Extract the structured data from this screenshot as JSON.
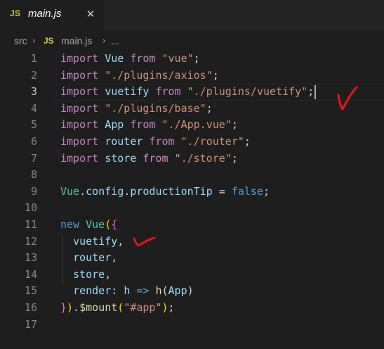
{
  "tab": {
    "badge": "JS",
    "filename": "main.js",
    "close": "✕"
  },
  "breadcrumb": {
    "folder": "src",
    "sep": "›",
    "badge": "JS",
    "file": "main.js",
    "ellipsis": "..."
  },
  "lines": [
    {
      "n": "1",
      "tokens": [
        [
          "kw",
          "import"
        ],
        [
          "sp",
          " "
        ],
        [
          "id",
          "Vue"
        ],
        [
          "sp",
          " "
        ],
        [
          "kw",
          "from"
        ],
        [
          "sp",
          " "
        ],
        [
          "str",
          "\"vue\""
        ],
        [
          "pun",
          ";"
        ]
      ]
    },
    {
      "n": "2",
      "tokens": [
        [
          "kw",
          "import"
        ],
        [
          "sp",
          " "
        ],
        [
          "str",
          "\"./plugins/axios\""
        ],
        [
          "pun",
          ";"
        ]
      ]
    },
    {
      "n": "3",
      "tokens": [
        [
          "kw",
          "import"
        ],
        [
          "sp",
          " "
        ],
        [
          "id",
          "vuetify"
        ],
        [
          "sp",
          " "
        ],
        [
          "kw",
          "from"
        ],
        [
          "sp",
          " "
        ],
        [
          "str",
          "\"./plugins/vuetify\""
        ],
        [
          "pun",
          ";"
        ]
      ]
    },
    {
      "n": "4",
      "tokens": [
        [
          "kw",
          "import"
        ],
        [
          "sp",
          " "
        ],
        [
          "str",
          "\"./plugins/base\""
        ],
        [
          "pun",
          ";"
        ]
      ]
    },
    {
      "n": "5",
      "tokens": [
        [
          "kw",
          "import"
        ],
        [
          "sp",
          " "
        ],
        [
          "id",
          "App"
        ],
        [
          "sp",
          " "
        ],
        [
          "kw",
          "from"
        ],
        [
          "sp",
          " "
        ],
        [
          "str",
          "\"./App.vue\""
        ],
        [
          "pun",
          ";"
        ]
      ]
    },
    {
      "n": "6",
      "tokens": [
        [
          "kw",
          "import"
        ],
        [
          "sp",
          " "
        ],
        [
          "id",
          "router"
        ],
        [
          "sp",
          " "
        ],
        [
          "kw",
          "from"
        ],
        [
          "sp",
          " "
        ],
        [
          "str",
          "\"./router\""
        ],
        [
          "pun",
          ";"
        ]
      ]
    },
    {
      "n": "7",
      "tokens": [
        [
          "kw",
          "import"
        ],
        [
          "sp",
          " "
        ],
        [
          "id",
          "store"
        ],
        [
          "sp",
          " "
        ],
        [
          "kw",
          "from"
        ],
        [
          "sp",
          " "
        ],
        [
          "str",
          "\"./store\""
        ],
        [
          "pun",
          ";"
        ]
      ]
    },
    {
      "n": "8",
      "tokens": []
    },
    {
      "n": "9",
      "tokens": [
        [
          "cls",
          "Vue"
        ],
        [
          "pun",
          "."
        ],
        [
          "id",
          "config"
        ],
        [
          "pun",
          "."
        ],
        [
          "id",
          "productionTip"
        ],
        [
          "sp",
          " "
        ],
        [
          "pun",
          "="
        ],
        [
          "sp",
          " "
        ],
        [
          "bool",
          "false"
        ],
        [
          "pun",
          ";"
        ]
      ]
    },
    {
      "n": "10",
      "tokens": []
    },
    {
      "n": "11",
      "tokens": [
        [
          "stor",
          "new"
        ],
        [
          "sp",
          " "
        ],
        [
          "cls",
          "Vue"
        ],
        [
          "b1",
          "("
        ],
        [
          "b2",
          "{"
        ]
      ]
    },
    {
      "n": "12",
      "tokens": [
        [
          "sp",
          "  "
        ],
        [
          "id",
          "vuetify"
        ],
        [
          "pun",
          ","
        ]
      ]
    },
    {
      "n": "13",
      "tokens": [
        [
          "sp",
          "  "
        ],
        [
          "id",
          "router"
        ],
        [
          "pun",
          ","
        ]
      ]
    },
    {
      "n": "14",
      "tokens": [
        [
          "sp",
          "  "
        ],
        [
          "id",
          "store"
        ],
        [
          "pun",
          ","
        ]
      ]
    },
    {
      "n": "15",
      "tokens": [
        [
          "sp",
          "  "
        ],
        [
          "id",
          "render"
        ],
        [
          "pun",
          ":"
        ],
        [
          "sp",
          " "
        ],
        [
          "id",
          "h"
        ],
        [
          "sp",
          " "
        ],
        [
          "stor",
          "=>"
        ],
        [
          "sp",
          " "
        ],
        [
          "fn",
          "h"
        ],
        [
          "pun",
          "("
        ],
        [
          "id",
          "App"
        ],
        [
          "pun",
          ")"
        ]
      ]
    },
    {
      "n": "16",
      "tokens": [
        [
          "b2",
          "}"
        ],
        [
          "b1",
          ")"
        ],
        [
          "pun",
          "."
        ],
        [
          "fn",
          "$mount"
        ],
        [
          "b1",
          "("
        ],
        [
          "str",
          "\"#app\""
        ],
        [
          "b1",
          ")"
        ],
        [
          "pun",
          ";"
        ]
      ]
    },
    {
      "n": "17",
      "tokens": []
    }
  ],
  "active_line": "3",
  "annotation_color": "#e0161c",
  "colors": {
    "background": "#1e1e1e",
    "keyword": "#c586c0",
    "variable": "#9cdcfe",
    "class": "#4ec9b0",
    "string": "#ce9178",
    "boolean": "#569cd6",
    "function": "#dcdcaa",
    "bracket1": "#ffd700",
    "bracket2": "#da70d6"
  }
}
